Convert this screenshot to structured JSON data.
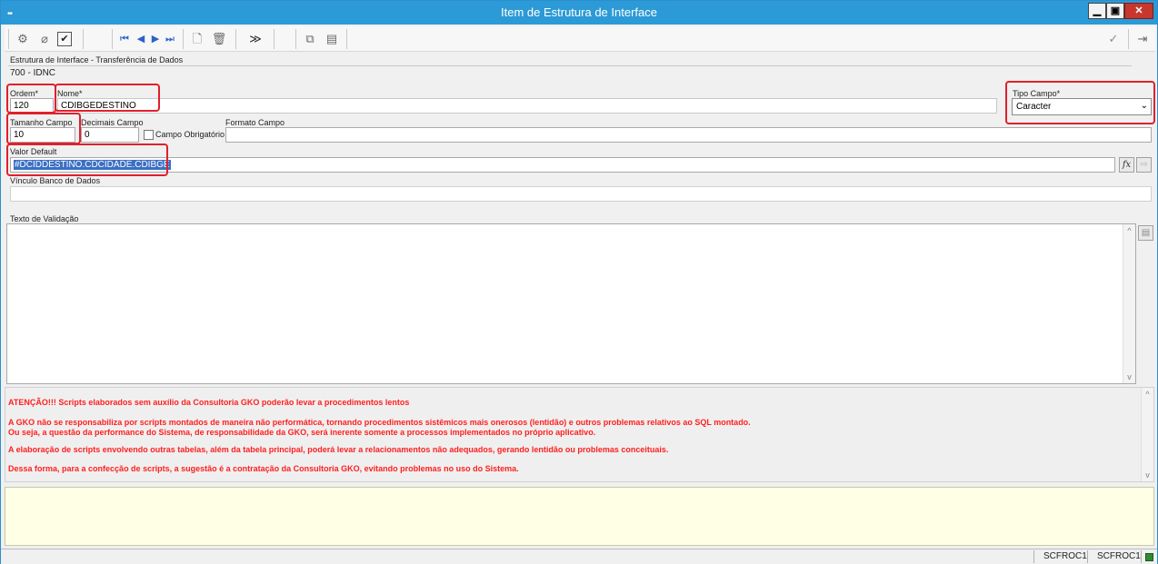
{
  "window": {
    "title": "Item de Estrutura de Interface",
    "dots": "••",
    "controls": {
      "minimize": "▁",
      "maximize": "▣",
      "close": "✕"
    }
  },
  "toolbar": {
    "icons": [
      "settings-icon",
      "attach-icon",
      "check-icon",
      "first-record-icon",
      "prev-record-icon",
      "next-record-icon",
      "last-record-icon",
      "new-document-icon",
      "delete-icon",
      "run-icon",
      "copy-icon",
      "save-icon",
      "confirm-icon",
      "exit-icon"
    ]
  },
  "form": {
    "estrutura_label": "Estrutura de Interface - Transferência de Dados",
    "estrutura_value": "700 - IDNC",
    "ordem_label": "Ordem*",
    "ordem_value": "120",
    "nome_label": "Nome*",
    "nome_value": "CDIBGEDESTINO",
    "tipo_label": "Tipo Campo*",
    "tipo_value": "Caracter",
    "tamanho_label": "Tamanho Campo",
    "tamanho_value": "10",
    "decimais_label": "Decimais Campo",
    "decimais_value": "0",
    "obrigatorio_label": "Campo Obrigatório",
    "formato_label": "Formato Campo",
    "formato_value": "",
    "valor_default_label": "Valor Default",
    "valor_default_value": "#DCIDDESTINO.CDCIDADE.CDIBGE",
    "fx_label": "fx",
    "vinculo_label": "Vínculo Banco de Dados",
    "vinculo_value": "",
    "texto_label": "Texto de Validação",
    "texto_value": ""
  },
  "warnings": [
    "ATENÇÃO!!! Scripts elaborados sem auxílio da Consultoria GKO poderão levar a procedimentos lentos",
    "A GKO não se responsabiliza por scripts montados de maneira não performática, tornando procedimentos sistêmicos mais onerosos (lentidão) e outros problemas relativos ao SQL montado.",
    "Ou seja, a questão da performance do Sistema, de responsabilidade da GKO, será inerente somente a processos implementados no próprio aplicativo.",
    "A elaboração de scripts envolvendo outras tabelas, além da tabela principal, poderá levar a relacionamentos não adequados, gerando lentidão ou problemas conceituais.",
    "Dessa forma, para a confecção de scripts, a sugestão é a contratação da Consultoria GKO, evitando problemas no uso do Sistema."
  ],
  "status": {
    "cell1": "SCFROC1",
    "cell2": "SCFROC1"
  },
  "colors": {
    "title_bar": "#2b9ad6",
    "highlight_box": "#e0202b",
    "warning_text": "#ff1f1f",
    "selection": "#3b6fc4"
  }
}
